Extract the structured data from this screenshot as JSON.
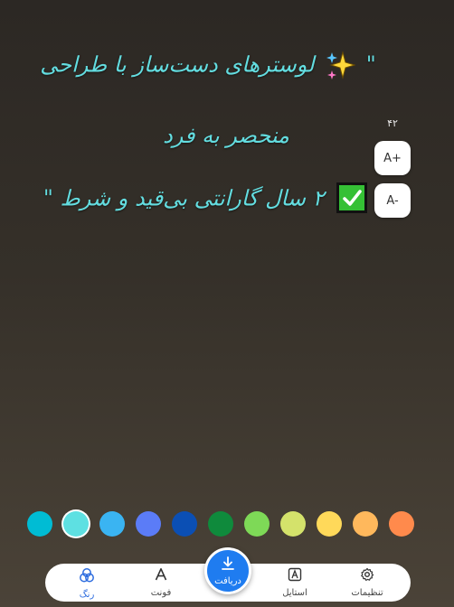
{
  "canvas": {
    "line1": {
      "open_quote": "\"",
      "text": "لوسترهای دست‌ساز با طراحی"
    },
    "line2": {
      "text": "منحصر به فرد"
    },
    "line3": {
      "text": "۲ سال گارانتی بی‌قید و شرط",
      "close_quote": "\""
    }
  },
  "font_size": {
    "value": "۴۲",
    "increase_label": "A+",
    "decrease_label": "A-"
  },
  "palette": {
    "selected": "#5ee0e2",
    "colors": [
      "#00bcd4",
      "#5ee0e2",
      "#3ab4f2",
      "#5b7cf7",
      "#0b4fb4",
      "#0f8a3c",
      "#7ed957",
      "#d4e26b",
      "#ffd95a",
      "#ffb85c",
      "#ff8a4c"
    ]
  },
  "bottom_nav": {
    "settings": "تنظیمات",
    "style": "استایل",
    "download": "دریافت",
    "font": "فونت",
    "color": "رنگ"
  }
}
